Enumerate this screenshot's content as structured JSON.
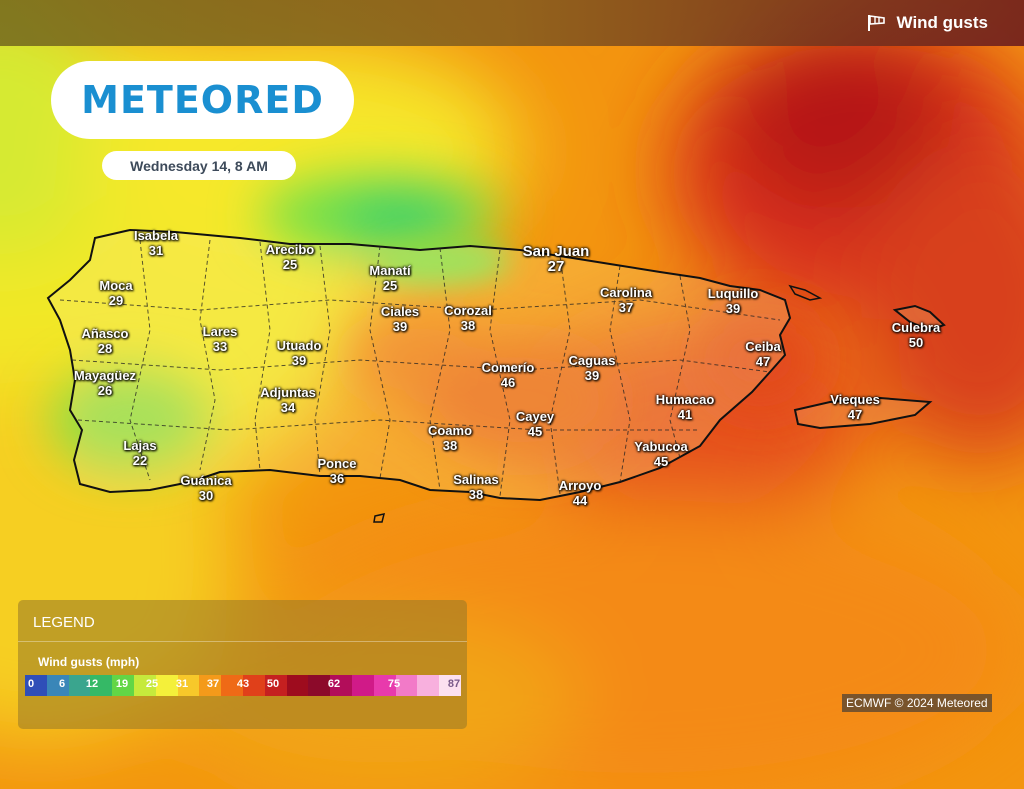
{
  "header": {
    "layer_label": "Wind gusts",
    "layer_icon": "windsock-icon"
  },
  "logo": {
    "text": "METEORED"
  },
  "date_label": "Wednesday 14, 8 AM",
  "cities": [
    {
      "name": "Isabela",
      "value": "31"
    },
    {
      "name": "Arecibo",
      "value": "25"
    },
    {
      "name": "Manatí",
      "value": "25"
    },
    {
      "name": "San Juan",
      "value": "27"
    },
    {
      "name": "Moca",
      "value": "29"
    },
    {
      "name": "Carolina",
      "value": "37"
    },
    {
      "name": "Luquillo",
      "value": "39"
    },
    {
      "name": "Ciales",
      "value": "39"
    },
    {
      "name": "Corozal",
      "value": "38"
    },
    {
      "name": "Culebra",
      "value": "50"
    },
    {
      "name": "Añasco",
      "value": "28"
    },
    {
      "name": "Lares",
      "value": "33"
    },
    {
      "name": "Utuado",
      "value": "39"
    },
    {
      "name": "Ceiba",
      "value": "47"
    },
    {
      "name": "Caguas",
      "value": "39"
    },
    {
      "name": "Comerío",
      "value": "46"
    },
    {
      "name": "Mayagüez",
      "value": "26"
    },
    {
      "name": "Adjuntas",
      "value": "34"
    },
    {
      "name": "Humacao",
      "value": "41"
    },
    {
      "name": "Vieques",
      "value": "47"
    },
    {
      "name": "Cayey",
      "value": "45"
    },
    {
      "name": "Coamo",
      "value": "38"
    },
    {
      "name": "Lajas",
      "value": "22"
    },
    {
      "name": "Yabucoa",
      "value": "45"
    },
    {
      "name": "Ponce",
      "value": "36"
    },
    {
      "name": "Guánica",
      "value": "30"
    },
    {
      "name": "Salinas",
      "value": "38"
    },
    {
      "name": "Arroyo",
      "value": "44"
    }
  ],
  "legend": {
    "title": "LEGEND",
    "subtitle": "Wind gusts (mph)",
    "colors": [
      "#2f4fb8",
      "#3a86b8",
      "#3aa58e",
      "#35b966",
      "#62d646",
      "#c6ea3c",
      "#f4f03a",
      "#f7c82a",
      "#f49a1a",
      "#ef6a16",
      "#e0401a",
      "#c52020",
      "#9e0c1e",
      "#8c0a2a",
      "#b20d5a",
      "#d01a88",
      "#e83aac",
      "#f27ac8",
      "#f8b0de",
      "#fce0f0"
    ],
    "labels": [
      "0",
      "6",
      "12",
      "19",
      "25",
      "31",
      "37",
      "43",
      "50",
      "62",
      "75",
      "87"
    ]
  },
  "credit": "ECMWF © 2024 Meteored"
}
